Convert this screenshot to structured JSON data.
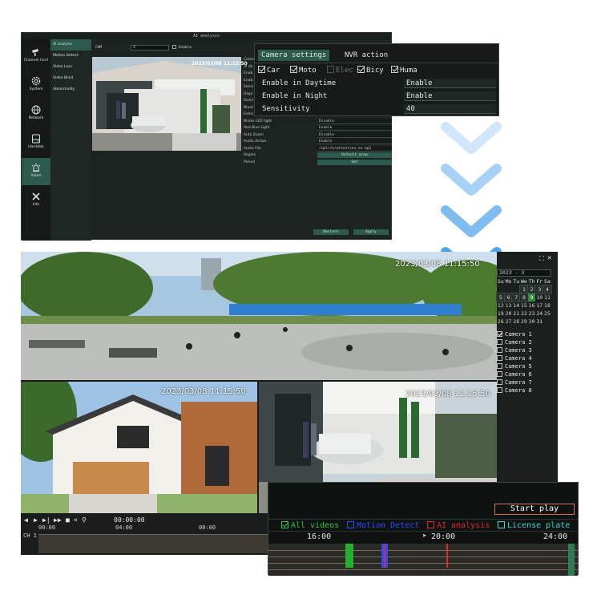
{
  "nvr": {
    "title": "AI analysis",
    "sidebar": [
      {
        "label": "Channel Conf",
        "icon": "camera-icon"
      },
      {
        "label": "System",
        "icon": "gear-icon"
      },
      {
        "label": "Network",
        "icon": "globe-icon"
      },
      {
        "label": "Harddisk",
        "icon": "harddisk-icon"
      },
      {
        "label": "Alarm",
        "icon": "alarm-icon",
        "active": true
      },
      {
        "label": "Info",
        "icon": "tools-icon"
      }
    ],
    "submenu": [
      "AI analysis",
      "Motion Detect",
      "Video Loss",
      "Video Blind",
      "Abnormality"
    ],
    "cam_label": "CAM",
    "cam_value": "3",
    "enable_label": "Enable",
    "timestamp": "2023/03/08 11:15:50",
    "settings": [
      "Camera",
      "AI de",
      "Enab",
      "Enab",
      "Sensi",
      "Displ",
      "Overl",
      "Bluet",
      "Extra",
      "Blinks LED light",
      "Red Blue Light",
      "Auto Zoom",
      "Audio Action",
      "Audio File",
      "Region",
      "Period"
    ],
    "values": {
      "led": "Disable",
      "redblue": "Enable",
      "zoom": "Disable",
      "audio": "Enable",
      "audio_file": "/opt/ch/attention_en.mp3",
      "region_btn": "Default area",
      "period_btn": "Set"
    },
    "restore_label": "Restore",
    "apply_label": "Apply"
  },
  "popup": {
    "tab_camera": "Camera settings",
    "tab_nvr": "NVR action",
    "objects": [
      {
        "label": "Car",
        "checked": true,
        "enabled": true
      },
      {
        "label": "Moto",
        "checked": true,
        "enabled": true
      },
      {
        "label": "Elec",
        "checked": false,
        "enabled": false
      },
      {
        "label": "Bicy",
        "checked": true,
        "enabled": true
      },
      {
        "label": "Huma",
        "checked": true,
        "enabled": true
      }
    ],
    "daytime_label": "Enable in Daytime",
    "daytime_value": "Enable",
    "night_label": "Enable in Night",
    "night_value": "Enable",
    "sensitivity_label": "Sensitivity",
    "sensitivity_value": "40"
  },
  "playback": {
    "timestamps": [
      "2023/03/08 11:15:50",
      "2023/03/08 11:15:50",
      "2023/03/08 11:15:50"
    ],
    "calendar": {
      "year": "2023",
      "month": "3",
      "headers": [
        "Su",
        "Mo",
        "Tu",
        "We",
        "Th",
        "Fr",
        "Sa"
      ],
      "weeks": [
        [
          "",
          "",
          "",
          "1",
          "2",
          "3",
          "4"
        ],
        [
          "5",
          "6",
          "7",
          "8",
          "9",
          "10",
          "11"
        ],
        [
          "12",
          "13",
          "14",
          "15",
          "16",
          "17",
          "18"
        ],
        [
          "19",
          "20",
          "21",
          "22",
          "23",
          "24",
          "25"
        ],
        [
          "26",
          "27",
          "28",
          "29",
          "30",
          "31",
          ""
        ]
      ],
      "selected_day": "9"
    },
    "cameras": [
      {
        "label": "Camera 1",
        "checked": true
      },
      {
        "label": "Camera 2",
        "checked": false
      },
      {
        "label": "Camera 3",
        "checked": false
      },
      {
        "label": "Camera 4",
        "checked": false
      },
      {
        "label": "Camera 5",
        "checked": false
      },
      {
        "label": "Camera 6",
        "checked": false
      },
      {
        "label": "Camera 7",
        "checked": false
      },
      {
        "label": "Camera 8",
        "checked": false
      }
    ],
    "time_readout": "00:00:00",
    "ticks": [
      "00:00",
      "04:00",
      "08:00"
    ],
    "channel_label": "CH 1"
  },
  "timeline": {
    "start_play": "Start play",
    "legend": [
      {
        "label": "All videos",
        "color": "#3fbf4f",
        "checked": true
      },
      {
        "label": "Motion Detect",
        "color": "#2b4bff",
        "checked": false
      },
      {
        "label": "AI analysis",
        "color": "#e02b2b",
        "checked": false
      },
      {
        "label": "License plate",
        "color": "#3fd6d6",
        "checked": false
      }
    ],
    "hours": [
      "16:00",
      "20:00",
      "24:00"
    ]
  },
  "colors": {
    "accent": "#2c5a4c",
    "chevron": "#5aaef0",
    "selected_day": "#2d8a3e"
  }
}
